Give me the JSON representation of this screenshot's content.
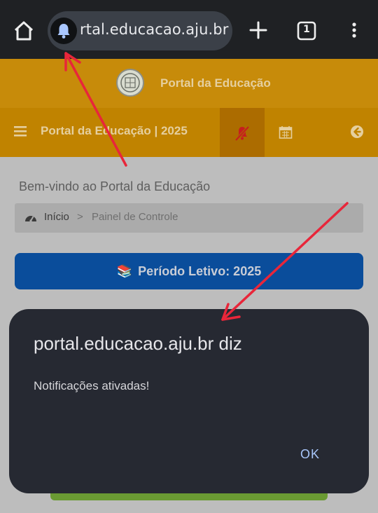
{
  "browser": {
    "url_visible": "rtal.educacao.aju.br",
    "tab_count": "1",
    "icons": {
      "home": "home-icon",
      "site_info": "bell-icon",
      "new_tab": "plus-icon",
      "tabs": "tab-count-icon",
      "menu": "more-vert-icon"
    }
  },
  "site": {
    "header_title": "Portal da Educação",
    "nav_title": "Portal da Educação | 2025",
    "welcome": "Bem-vindo ao Portal da Educação",
    "breadcrumb": {
      "home": "Início",
      "separator": ">",
      "current": "Painel de Controle"
    },
    "period_button": {
      "emoji": "📚",
      "label": "Período Letivo: 2025"
    }
  },
  "dialog": {
    "title": "portal.educacao.aju.br diz",
    "message": "Notificações ativadas!",
    "ok_label": "OK"
  },
  "colors": {
    "chrome_bg": "#1f2124",
    "header_bg": "#c78b0a",
    "nav_bg": "#c08300",
    "period_button_bg": "#0a4d9b",
    "dialog_bg": "#262932",
    "dialog_ok": "#a8c6fa",
    "annotation_arrow": "#e8263a"
  }
}
